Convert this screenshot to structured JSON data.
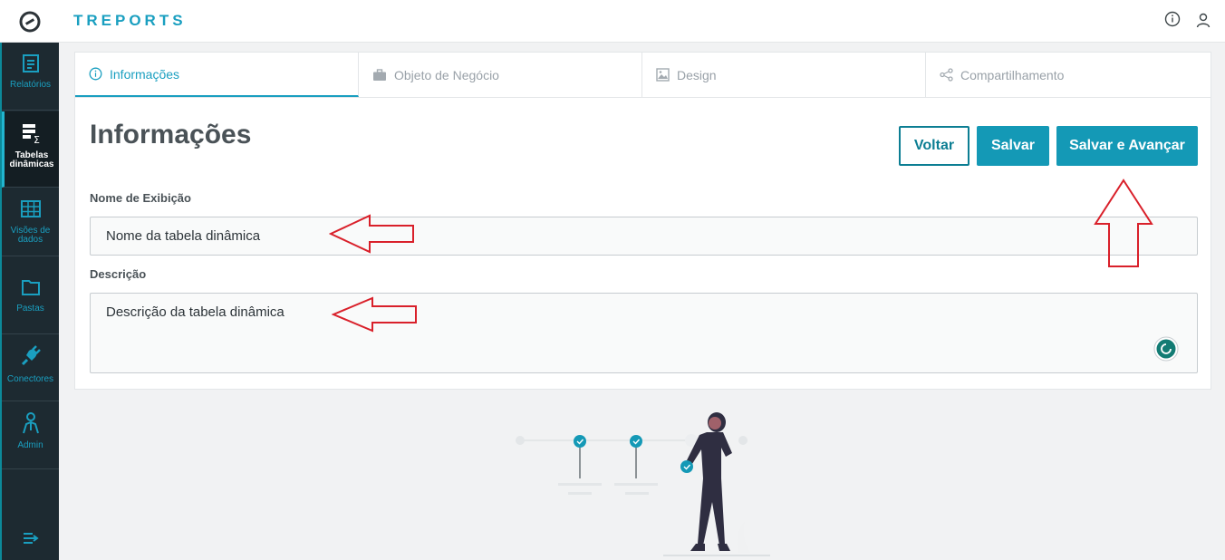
{
  "app": {
    "brand": "TREPORTS"
  },
  "header": {
    "icons": [
      "logo-icon",
      "info-icon",
      "user-icon"
    ]
  },
  "sidebar": {
    "items": [
      {
        "label": "Relatórios",
        "icon": "report-icon"
      },
      {
        "label": "Tabelas dinâmicas",
        "icon": "pivot-table-icon",
        "active": true
      },
      {
        "label": "Visões de dados",
        "icon": "grid-icon"
      },
      {
        "label": "Pastas",
        "icon": "folder-icon"
      },
      {
        "label": "Conectores",
        "icon": "plug-icon"
      },
      {
        "label": "Admin",
        "icon": "admin-icon"
      }
    ]
  },
  "tabs": [
    {
      "label": "Informações",
      "icon": "info-icon",
      "active": true
    },
    {
      "label": "Objeto de Negócio",
      "icon": "briefcase-icon"
    },
    {
      "label": "Design",
      "icon": "image-icon"
    },
    {
      "label": "Compartilhamento",
      "icon": "share-icon"
    }
  ],
  "form": {
    "title": "Informações",
    "back_label": "Voltar",
    "save_label": "Salvar",
    "save_next_label": "Salvar e Avançar",
    "name_label": "Nome de Exibição",
    "name_value": "Nome da tabela dinâmica",
    "description_label": "Descrição",
    "description_value": "Descrição da tabela dinâmica"
  },
  "colors": {
    "accent": "#1a9fc0",
    "sidebar": "#1d2a31",
    "annotation": "#d9202a"
  }
}
